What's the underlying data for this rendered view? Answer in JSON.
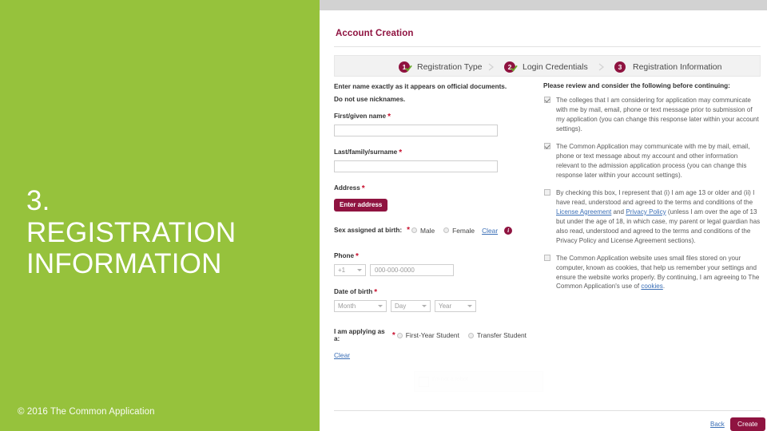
{
  "slide": {
    "number_title": "3.\nREGISTRATION INFORMATION",
    "title_line1": "3.",
    "title_line2": "REGISTRATION",
    "title_line3": "INFORMATION",
    "copyright": "© 2016 The Common Application",
    "panel_color": "#96c23c",
    "accent_color": "#8f1340"
  },
  "app": {
    "card_title": "Account Creation",
    "stepper": [
      {
        "number": "1",
        "label": "Registration Type",
        "completed": true
      },
      {
        "number": "2",
        "label": "Login Credentials",
        "completed": true
      },
      {
        "number": "3",
        "label": "Registration Information",
        "completed": false
      }
    ]
  },
  "form": {
    "helper_line1": "Enter name exactly as it appears on official documents.",
    "helper_line2": "Do not use nicknames.",
    "first_name": {
      "label": "First/given name",
      "value": "",
      "required": "*"
    },
    "last_name": {
      "label": "Last/family/surname",
      "value": "",
      "required": "*"
    },
    "address": {
      "label": "Address",
      "button_label": "Enter address",
      "required": "*"
    },
    "sex": {
      "label": "Sex assigned at birth:",
      "required": "*",
      "option_male": "Male",
      "option_female": "Female",
      "clear_label": "Clear",
      "info_glyph": "i",
      "selected": ""
    },
    "phone": {
      "label": "Phone",
      "required": "*",
      "country_code": "+1",
      "placeholder": "000-000-0000",
      "value": ""
    },
    "dob": {
      "label": "Date of birth",
      "required": "*",
      "month": "Month",
      "day": "Day",
      "year": "Year"
    },
    "applying_as": {
      "label": "I am applying as a:",
      "required": "*",
      "option_first_year": "First-Year Student",
      "option_transfer": "Transfer Student",
      "clear_label": "Clear",
      "selected": ""
    }
  },
  "consent": {
    "heading": "Please review and consider the following before continuing:",
    "items": [
      {
        "checked": true,
        "text": "The colleges that I am considering for application may communicate with me by mail, email, phone or text message prior to submission of my application (you can change this response later within your account settings)."
      },
      {
        "checked": true,
        "text": "The Common Application may communicate with me by mail, email, phone or text message about my account and other information relevant to the admission application process (you can change this response later within your account settings)."
      },
      {
        "checked": false,
        "text_a": "By checking this box, I represent that (i) I am age 13 or older and (ii) I have read, understood and agreed to the terms and conditions of the ",
        "link_1": "License Agreement",
        "text_b": " and ",
        "link_2": "Privacy Policy",
        "text_c": " (unless I am over the age of 13 but under the age of 18, in which case, my parent or legal guardian has also read, understood and agreed to the terms and conditions of the Privacy Policy and License Agreement sections)."
      },
      {
        "checked": false,
        "text_a": "The Common Application website uses small files stored on your computer, known as cookies, that help us remember your settings and ensure the website works properly. By continuing, I am agreeing to The Common Application's use of ",
        "link_1": "cookies",
        "text_c": "."
      }
    ]
  },
  "captcha": {
    "label": "I'm not a robot"
  },
  "footer": {
    "back_label": "Back",
    "create_label": "Create"
  }
}
